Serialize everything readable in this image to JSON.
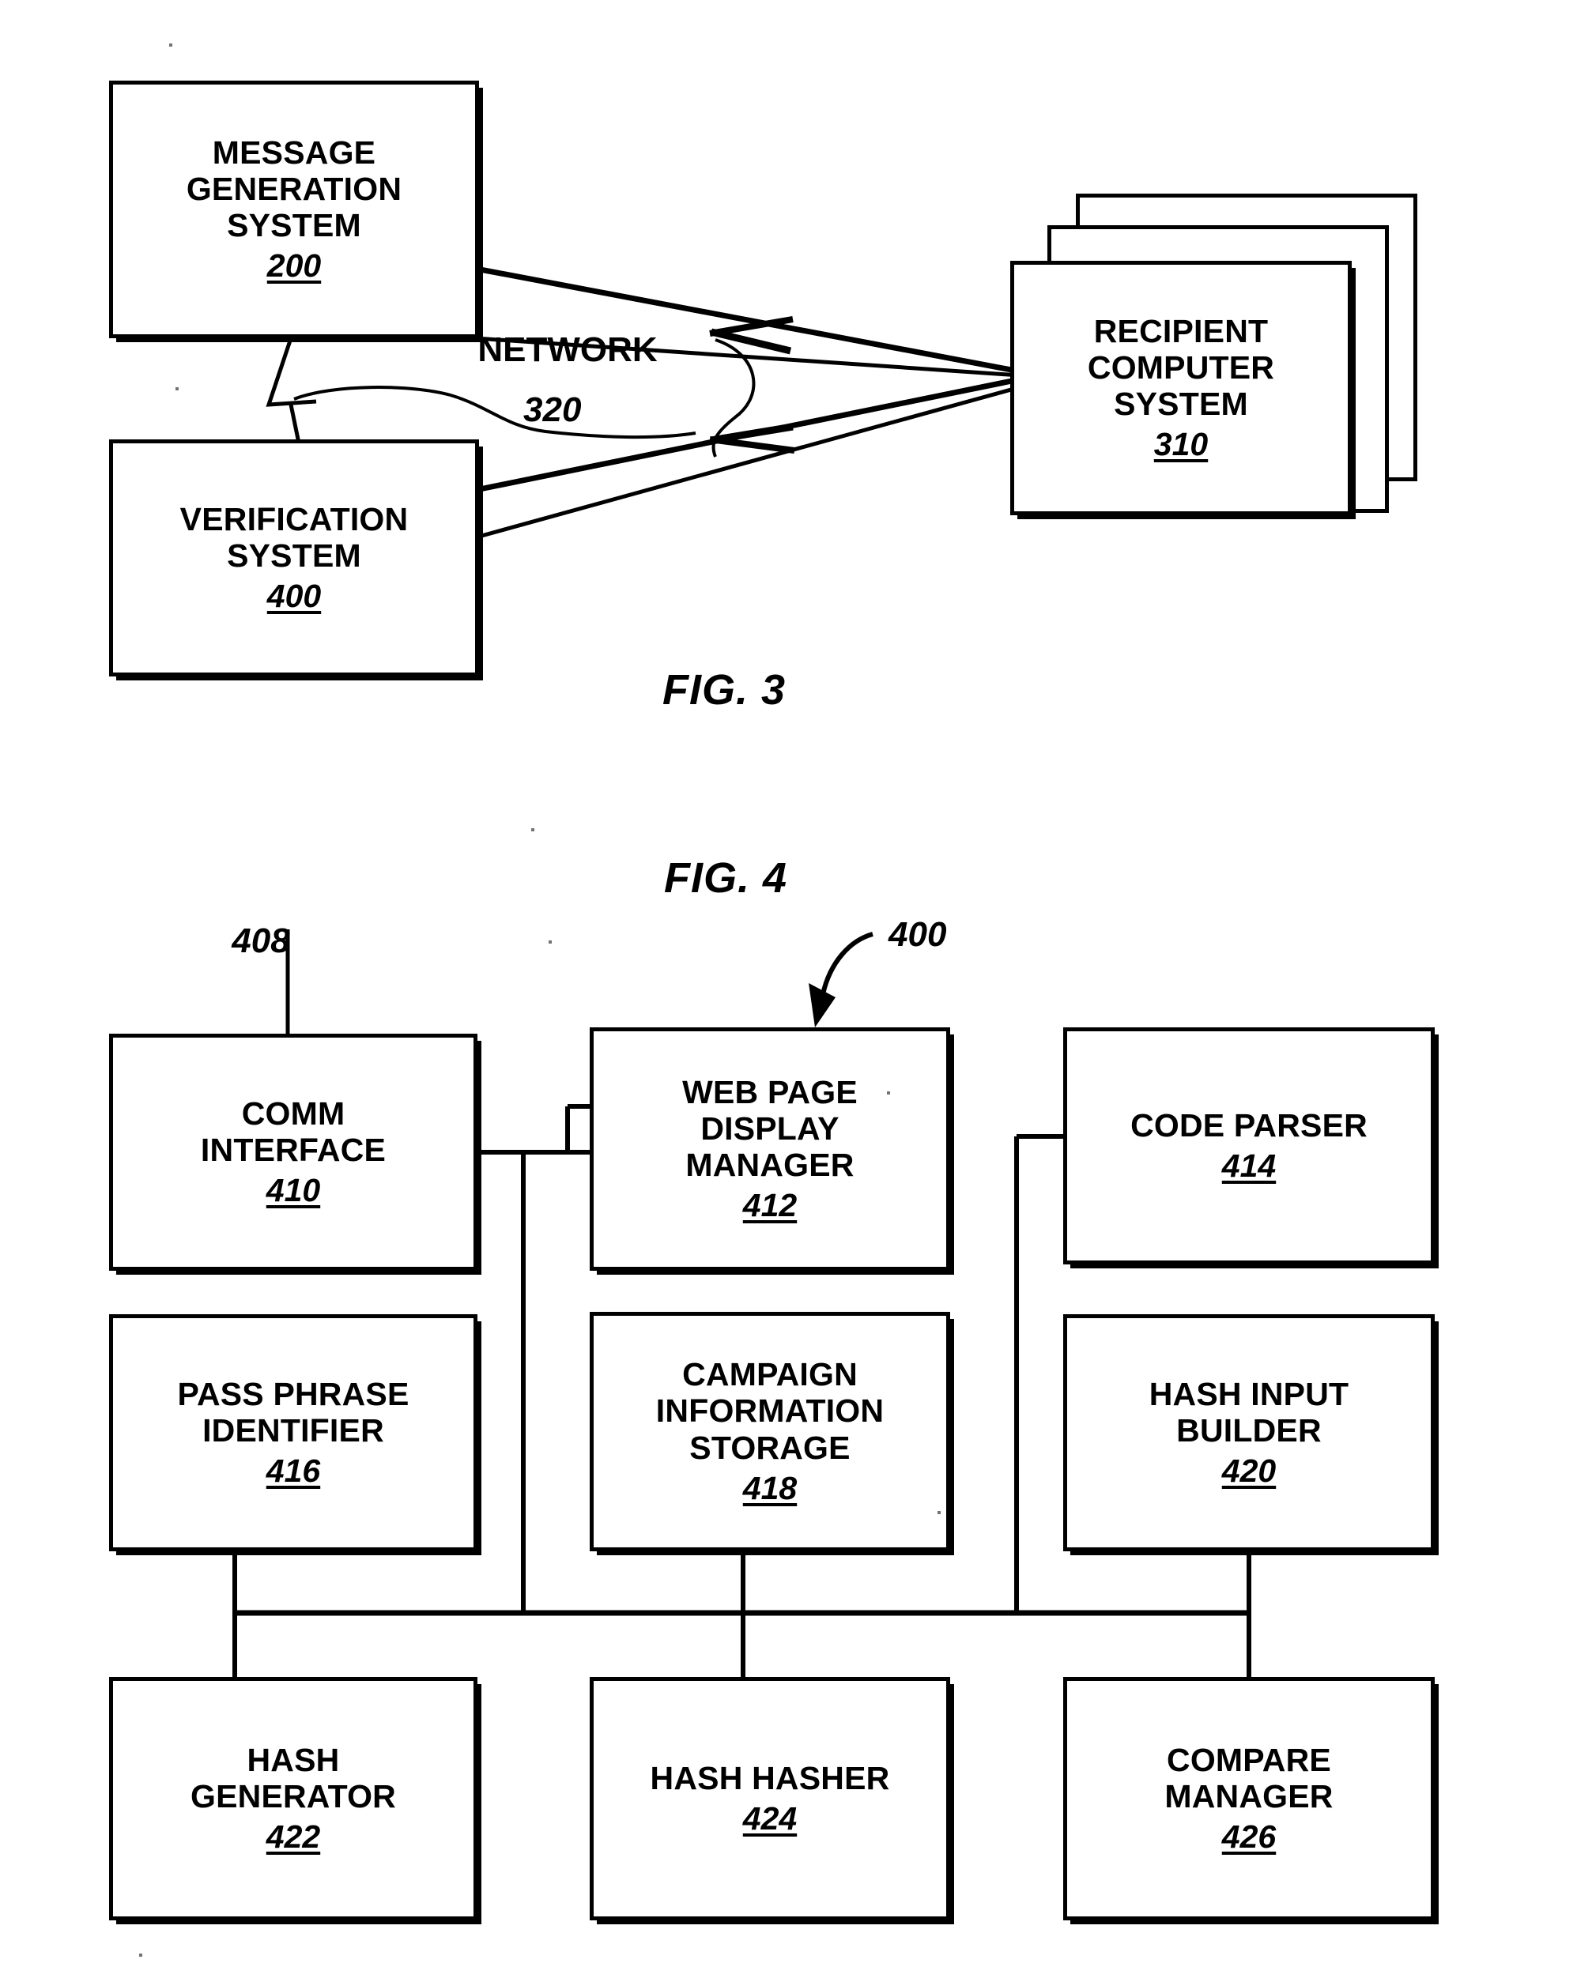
{
  "document": {
    "type": "patent-figure-sheet",
    "figures": [
      "FIG. 3",
      "FIG. 4"
    ]
  },
  "fig3": {
    "label": "FIG. 3",
    "network": {
      "label": "NETWORK",
      "refnum": "320"
    },
    "boxes": [
      {
        "id": "message-generation-system",
        "text": "MESSAGE\nGENERATION\nSYSTEM",
        "refnum": "200"
      },
      {
        "id": "verification-system",
        "text": "VERIFICATION\nSYSTEM",
        "refnum": "400"
      },
      {
        "id": "recipient-computer-system",
        "text": "RECIPIENT\nCOMPUTER\nSYSTEM",
        "refnum": "310",
        "stacked": true,
        "stack_count": 3
      }
    ]
  },
  "fig4": {
    "label": "FIG. 4",
    "system_refnum": "400",
    "bus_refnum": "408",
    "boxes": [
      {
        "id": "comm-interface",
        "text": "COMM\nINTERFACE",
        "refnum": "410"
      },
      {
        "id": "web-page-display-manager",
        "text": "WEB PAGE\nDISPLAY\nMANAGER",
        "refnum": "412"
      },
      {
        "id": "code-parser",
        "text": "CODE PARSER",
        "refnum": "414"
      },
      {
        "id": "pass-phrase-identifier",
        "text": "PASS PHRASE\nIDENTIFIER",
        "refnum": "416"
      },
      {
        "id": "campaign-information-storage",
        "text": "CAMPAIGN\nINFORMATION\nSTORAGE",
        "refnum": "418"
      },
      {
        "id": "hash-input-builder",
        "text": "HASH INPUT\nBUILDER",
        "refnum": "420"
      },
      {
        "id": "hash-generator",
        "text": "HASH\nGENERATOR",
        "refnum": "422"
      },
      {
        "id": "hash-hasher",
        "text": "HASH HASHER",
        "refnum": "424"
      },
      {
        "id": "compare-manager",
        "text": "COMPARE\nMANAGER",
        "refnum": "426"
      }
    ]
  },
  "colors": {
    "ink": "#000000",
    "paper": "#ffffff"
  }
}
